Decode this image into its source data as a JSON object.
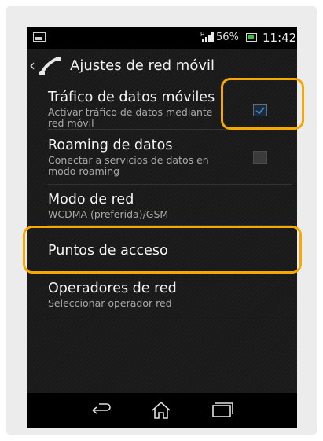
{
  "status_bar": {
    "signal_badge": "H",
    "battery_percent": "56%",
    "time": "11:42"
  },
  "action_bar": {
    "title": "Ajustes de red móvil"
  },
  "settings": [
    {
      "title": "Tráfico de datos móviles",
      "subtitle": "Activar tráfico de datos mediante red móvil",
      "checkbox": "checked"
    },
    {
      "title": "Roaming de datos",
      "subtitle": "Conectar a servicios de datos en modo roaming",
      "checkbox": "unchecked"
    },
    {
      "title": "Modo de red",
      "subtitle": "WCDMA (preferida)/GSM"
    },
    {
      "title": "Puntos de acceso"
    },
    {
      "title": "Operadores de red",
      "subtitle": "Seleccionar operador red"
    }
  ],
  "nav_bar": {
    "icons": [
      "back-icon",
      "home-icon",
      "recent-apps-icon"
    ]
  },
  "colors": {
    "highlight": "#f5a800",
    "check_accent": "#2f86d6",
    "background": "#1a1a1a"
  }
}
